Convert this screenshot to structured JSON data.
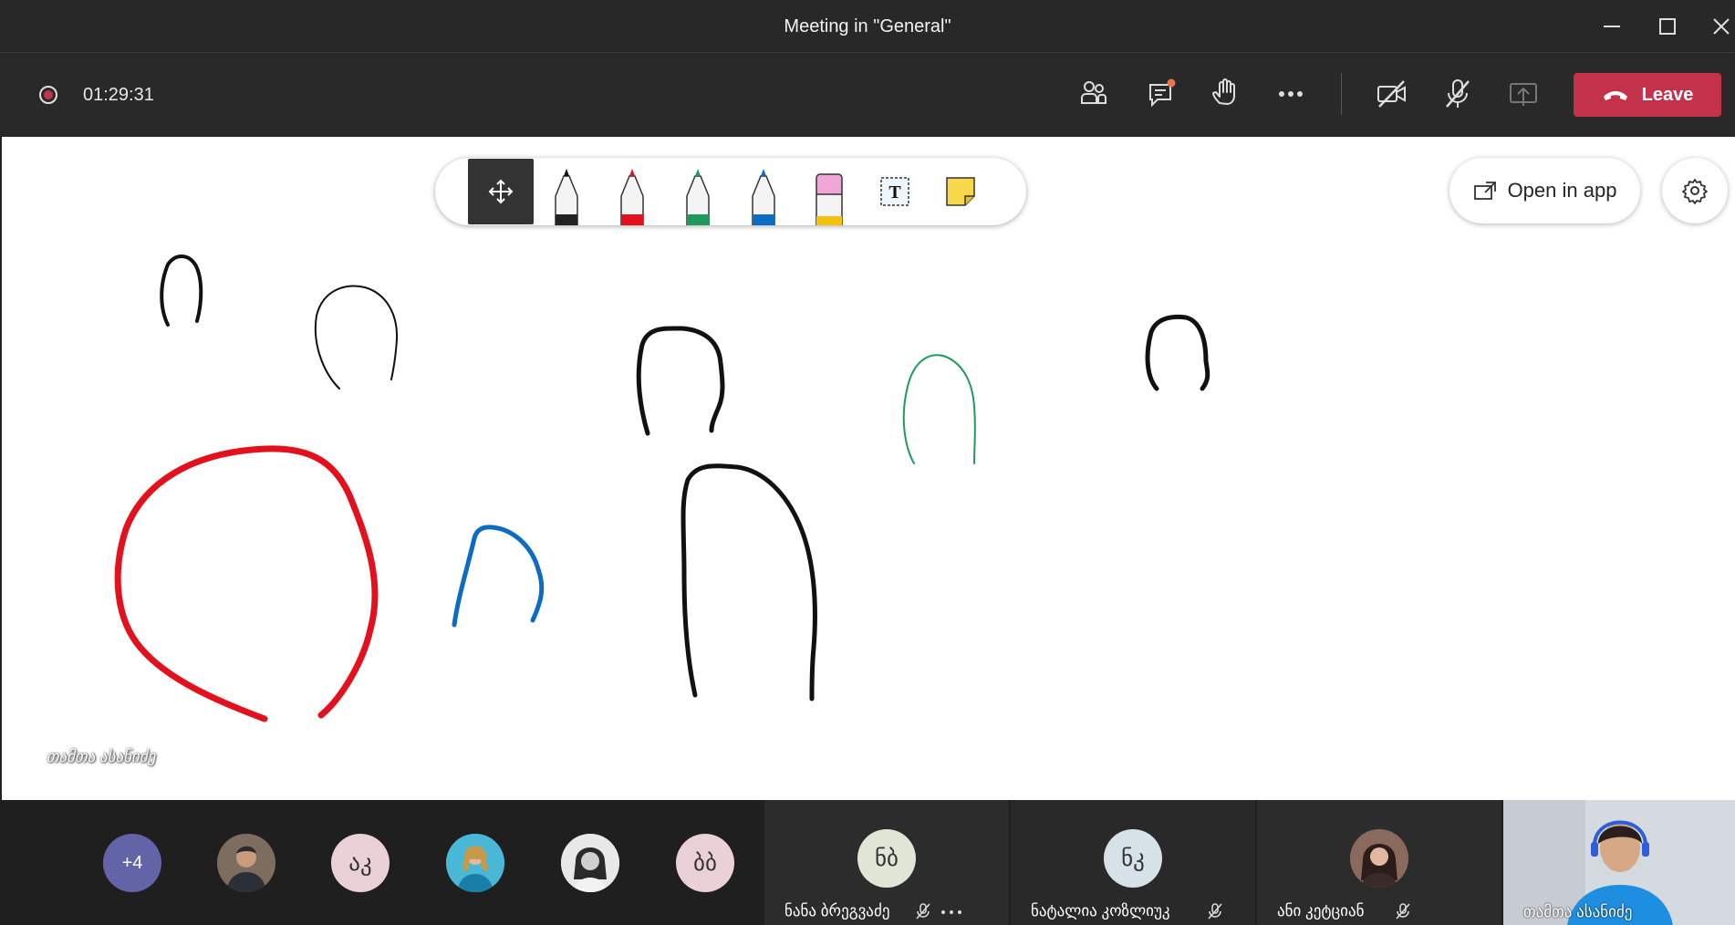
{
  "window": {
    "title": "Meeting in \"General\""
  },
  "topbar": {
    "timer": "01:29:31",
    "leave_label": "Leave",
    "icons": [
      "participants-icon",
      "chat-icon",
      "raise-hand-icon",
      "more-options-icon",
      "camera-off-icon",
      "mic-off-icon",
      "share-tray-icon"
    ]
  },
  "whiteboard": {
    "tools": [
      "pan-tool",
      "black-pen",
      "red-pen",
      "green-pen",
      "blue-pen",
      "highlighter",
      "text-tool",
      "sticky-note"
    ],
    "open_in_app_label": "Open in app",
    "presenter_label": "თამთა ასანიძე"
  },
  "participants": {
    "overflow_label": "+4",
    "small_avatars": [
      {
        "kind": "photo",
        "initials": ""
      },
      {
        "kind": "initials",
        "initials": "აკ",
        "color": "#ead1d8"
      },
      {
        "kind": "photo",
        "initials": ""
      },
      {
        "kind": "photo",
        "initials": ""
      },
      {
        "kind": "initials",
        "initials": "ბბ",
        "color": "#ead1d8"
      }
    ],
    "tiles": [
      {
        "initials": "ნბ",
        "name": "ნანა ბრეგვაძე",
        "color": "#dfe6d6"
      },
      {
        "initials": "ნკ",
        "name": "ნატალია კოზლიუკ",
        "color": "#d6e2e8"
      },
      {
        "initials": "",
        "name": "ანი კეტციან"
      }
    ],
    "self": {
      "name": "თამთა ასანიძე"
    }
  },
  "colors": {
    "accent_leave": "#c4314b",
    "ink_red": "#e3101e",
    "ink_blue": "#0b6cc2",
    "ink_green": "#1e9b5a",
    "ink_black": "#111111"
  }
}
